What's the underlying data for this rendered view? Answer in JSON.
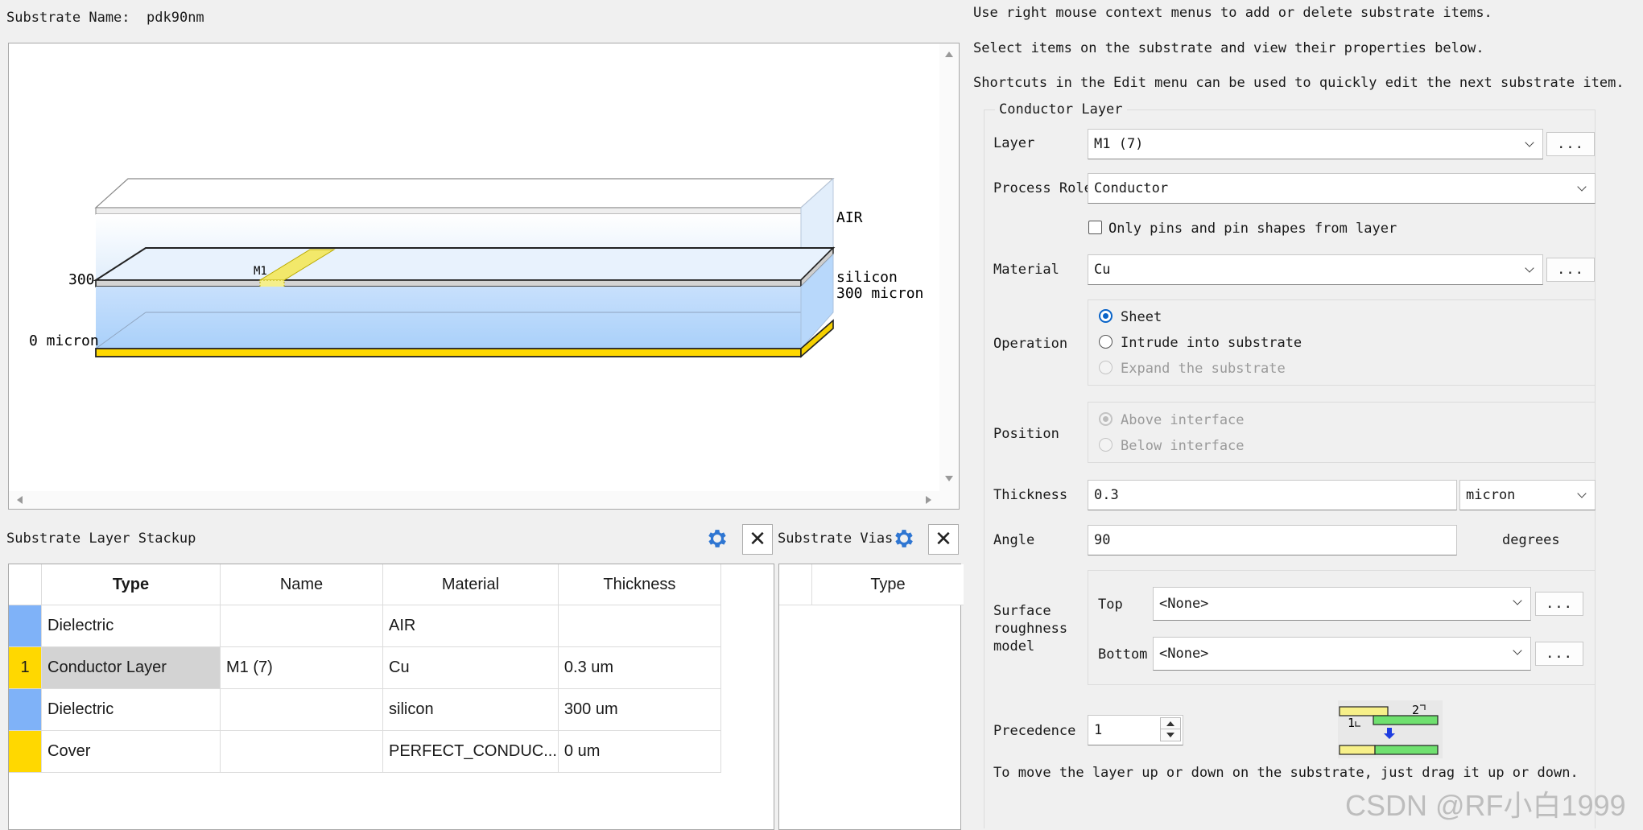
{
  "substrate": {
    "name_label": "Substrate Name:",
    "name_value": "pdk90nm"
  },
  "view3d": {
    "labels": {
      "air": "AIR",
      "silicon": "silicon",
      "silicon_thickness": "300 micron",
      "y300": "300",
      "y0": "0 micron",
      "m1": "M1"
    }
  },
  "stackup": {
    "title": "Substrate Layer Stackup",
    "columns": [
      "Type",
      "Name",
      "Material",
      "Thickness"
    ],
    "rows": [
      {
        "idx": "",
        "color": "#7fb2f8",
        "type": "Dielectric",
        "name": "",
        "material": "AIR",
        "thickness": ""
      },
      {
        "idx": "1",
        "color": "#ffd800",
        "type": "Conductor Layer",
        "name": "M1 (7)",
        "material": "Cu",
        "thickness": "0.3 um"
      },
      {
        "idx": "",
        "color": "#7fb2f8",
        "type": "Dielectric",
        "name": "",
        "material": "silicon",
        "thickness": "300 um"
      },
      {
        "idx": "",
        "color": "#ffd800",
        "type": "Cover",
        "name": "",
        "material": "PERFECT_CONDUC...",
        "thickness": "0 um"
      }
    ]
  },
  "vias": {
    "title": "Substrate Vias",
    "columns": [
      "Type"
    ]
  },
  "help": {
    "line1": "Use right mouse context menus to add or delete substrate items.",
    "line2": "Select items on the substrate and view their properties below.",
    "line3": "Shortcuts in the Edit menu can be used to quickly edit the next substrate item."
  },
  "conductor": {
    "group_title": "Conductor Layer",
    "layer_label": "Layer",
    "layer_value": "M1 (7)",
    "role_label": "Process Role",
    "role_value": "Conductor",
    "pins_only_label": "Only pins and pin shapes from layer",
    "pins_only_checked": false,
    "material_label": "Material",
    "material_value": "Cu",
    "operation_label": "Operation",
    "operation_options": [
      "Sheet",
      "Intrude into substrate",
      "Expand the substrate"
    ],
    "operation_selected": "Sheet",
    "position_label": "Position",
    "position_options": [
      "Above interface",
      "Below interface"
    ],
    "position_selected": "Above interface",
    "thickness_label": "Thickness",
    "thickness_value": "0.3",
    "thickness_unit": "micron",
    "angle_label": "Angle",
    "angle_value": "90",
    "angle_unit": "degrees",
    "roughness_label": "Surface roughness model",
    "top_label": "Top",
    "top_value": "<None>",
    "bottom_label": "Bottom",
    "bottom_value": "<None>",
    "precedence_label": "Precedence",
    "precedence_value": "1",
    "precedence_fig": {
      "n1": "1",
      "n2": "2"
    },
    "hint": "To move the layer up or down on the substrate, just drag it up or down.",
    "ellipsis": "..."
  },
  "watermark": "CSDN @RF小白1999"
}
